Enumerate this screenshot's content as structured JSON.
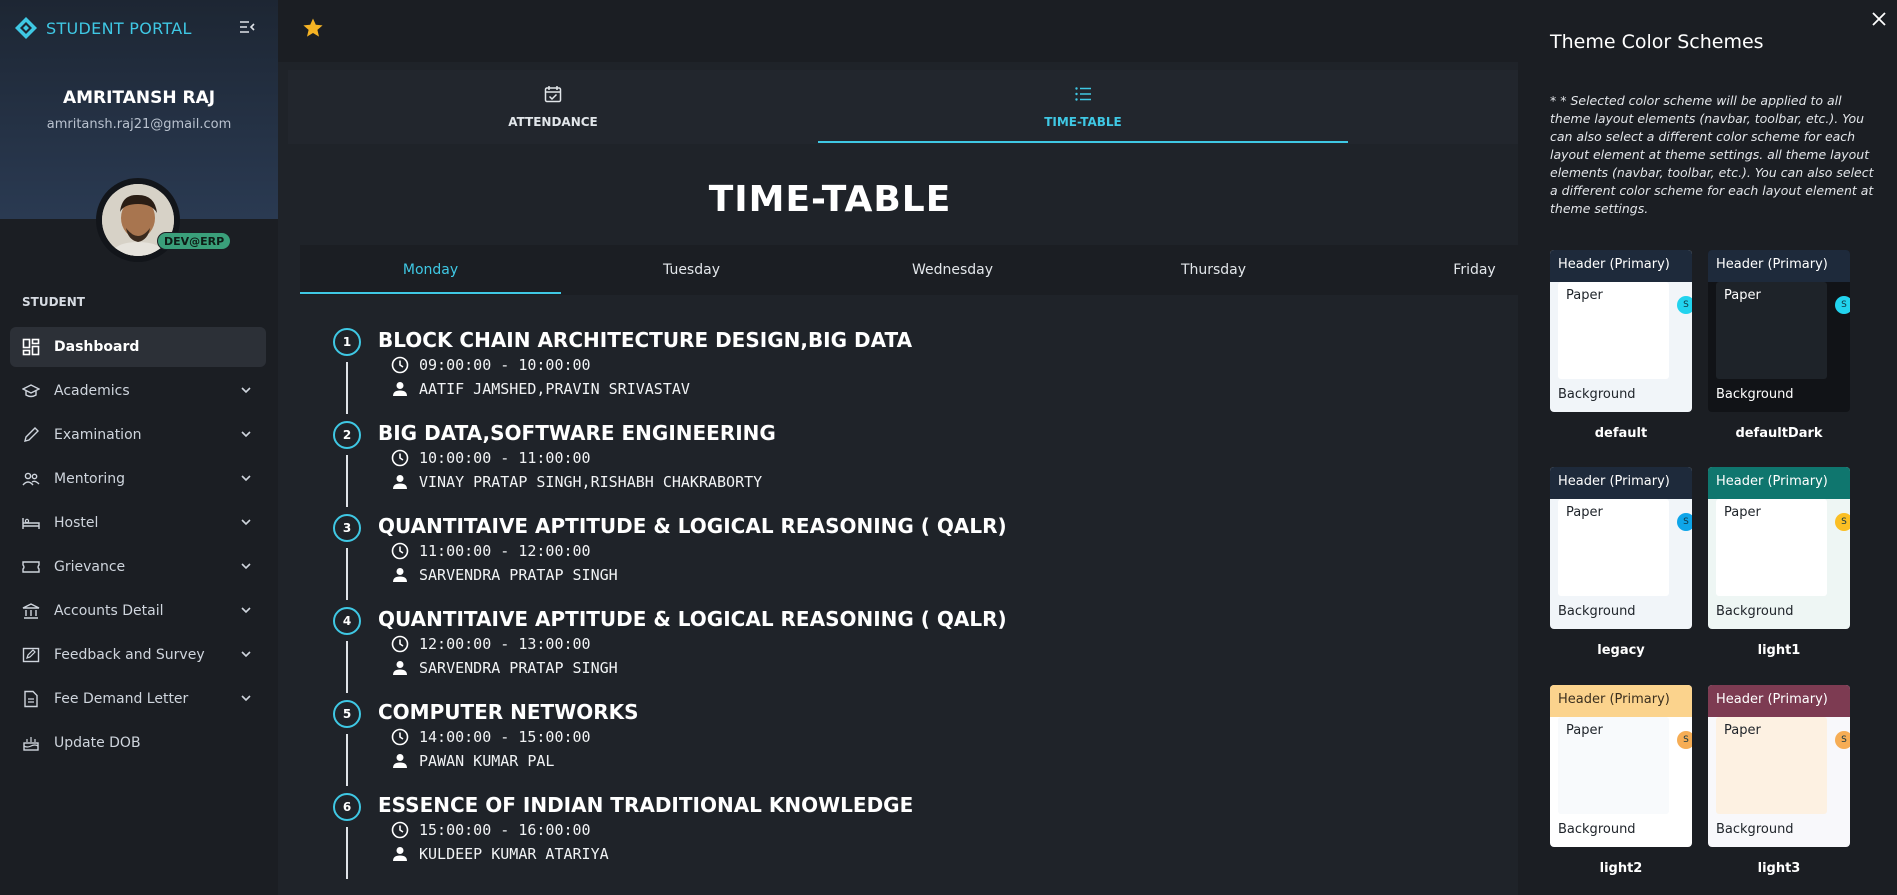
{
  "brand": {
    "title": "STUDENT PORTAL"
  },
  "user": {
    "name": "AMRITANSH RAJ",
    "email": "amritansh.raj21@gmail.com",
    "badge": "DEV@ERP"
  },
  "sidebar": {
    "section": "STUDENT",
    "items": [
      {
        "label": "Dashboard",
        "icon": "dashboard-icon",
        "active": true,
        "expandable": false
      },
      {
        "label": "Academics",
        "icon": "school-icon",
        "active": false,
        "expandable": true
      },
      {
        "label": "Examination",
        "icon": "pencil-icon",
        "active": false,
        "expandable": true
      },
      {
        "label": "Mentoring",
        "icon": "people-icon",
        "active": false,
        "expandable": true
      },
      {
        "label": "Hostel",
        "icon": "bed-icon",
        "active": false,
        "expandable": true
      },
      {
        "label": "Grievance",
        "icon": "ticket-icon",
        "active": false,
        "expandable": true
      },
      {
        "label": "Accounts Detail",
        "icon": "bank-icon",
        "active": false,
        "expandable": true
      },
      {
        "label": "Feedback and Survey",
        "icon": "feedback-icon",
        "active": false,
        "expandable": true
      },
      {
        "label": "Fee Demand Letter",
        "icon": "document-icon",
        "active": false,
        "expandable": true
      },
      {
        "label": "Update DOB",
        "icon": "cake-icon",
        "active": false,
        "expandable": false
      }
    ]
  },
  "tabs": [
    {
      "label": "ATTENDANCE",
      "icon": "calendar-check-icon",
      "active": false
    },
    {
      "label": "TIME-TABLE",
      "icon": "list-icon",
      "active": true
    }
  ],
  "timetable": {
    "title": "TIME-TABLE",
    "days": [
      {
        "label": "Monday",
        "active": true
      },
      {
        "label": "Tuesday",
        "active": false
      },
      {
        "label": "Wednesday",
        "active": false
      },
      {
        "label": "Thursday",
        "active": false
      },
      {
        "label": "Friday",
        "active": false
      }
    ],
    "entries": [
      {
        "num": "1",
        "subject": "BLOCK CHAIN ARCHITECTURE DESIGN,BIG DATA",
        "time": "09:00:00 - 10:00:00",
        "teacher": "AATIF JAMSHED,PRAVIN SRIVASTAV"
      },
      {
        "num": "2",
        "subject": "BIG DATA,SOFTWARE ENGINEERING",
        "time": "10:00:00 - 11:00:00",
        "teacher": "VINAY PRATAP SINGH,RISHABH CHAKRABORTY"
      },
      {
        "num": "3",
        "subject": "QUANTITAIVE APTITUDE & LOGICAL REASONING ( QALR)",
        "time": "11:00:00 - 12:00:00",
        "teacher": "SARVENDRA PRATAP SINGH"
      },
      {
        "num": "4",
        "subject": "QUANTITAIVE APTITUDE & LOGICAL REASONING ( QALR)",
        "time": "12:00:00 - 13:00:00",
        "teacher": "SARVENDRA PRATAP SINGH"
      },
      {
        "num": "5",
        "subject": "COMPUTER NETWORKS",
        "time": "14:00:00 - 15:00:00",
        "teacher": "PAWAN KUMAR PAL"
      },
      {
        "num": "6",
        "subject": "ESSENCE OF INDIAN TRADITIONAL KNOWLEDGE",
        "time": "15:00:00 - 16:00:00",
        "teacher": "KULDEEP KUMAR ATARIYA"
      }
    ]
  },
  "panel": {
    "title": "Theme Color Schemes",
    "description": "* * Selected color scheme will be applied to all theme layout elements (navbar, toolbar, etc.). You can also select a different color scheme for each layout element at theme settings. all theme layout elements (navbar, toolbar, etc.). You can also select a different color scheme for each layout element at theme settings.",
    "header_label": "Header (Primary)",
    "paper_label": "Paper",
    "background_label": "Background",
    "secondary_label": "S",
    "schemes": [
      {
        "name": "default",
        "header_bg": "#1e2a3b",
        "header_fg": "#ffffff",
        "paper_bg": "#ffffff",
        "paper_fg": "#1e2329",
        "bg": "#f1f5f9",
        "bg_fg": "#1e2329",
        "dot": "#22d3ee"
      },
      {
        "name": "defaultDark",
        "header_bg": "#1e2a3b",
        "header_fg": "#ffffff",
        "paper_bg": "#1e2329",
        "paper_fg": "#ffffff",
        "bg": "#111317",
        "bg_fg": "#ffffff",
        "dot": "#22d3ee"
      },
      {
        "name": "legacy",
        "header_bg": "#1e2a3b",
        "header_fg": "#ffffff",
        "paper_bg": "#ffffff",
        "paper_fg": "#1e2329",
        "bg": "#f1f5f9",
        "bg_fg": "#1e2329",
        "dot": "#0ea5e9"
      },
      {
        "name": "light1",
        "header_bg": "#0f766e",
        "header_fg": "#ffffff",
        "paper_bg": "#ffffff",
        "paper_fg": "#1e2329",
        "bg": "#eef6f4",
        "bg_fg": "#1e2329",
        "dot": "#fbbf24"
      },
      {
        "name": "light2",
        "header_bg": "#fbd38d",
        "header_fg": "#3b2f1e",
        "paper_bg": "#f8fafc",
        "paper_fg": "#1e2329",
        "bg": "#ffffff",
        "bg_fg": "#1e2329",
        "dot": "#f6ad55"
      },
      {
        "name": "light3",
        "header_bg": "#7d3b52",
        "header_fg": "#ffffff",
        "paper_bg": "#fdf1e2",
        "paper_fg": "#1e2329",
        "bg": "#f8f8fb",
        "bg_fg": "#1e2329",
        "dot": "#f6ad55"
      }
    ]
  }
}
